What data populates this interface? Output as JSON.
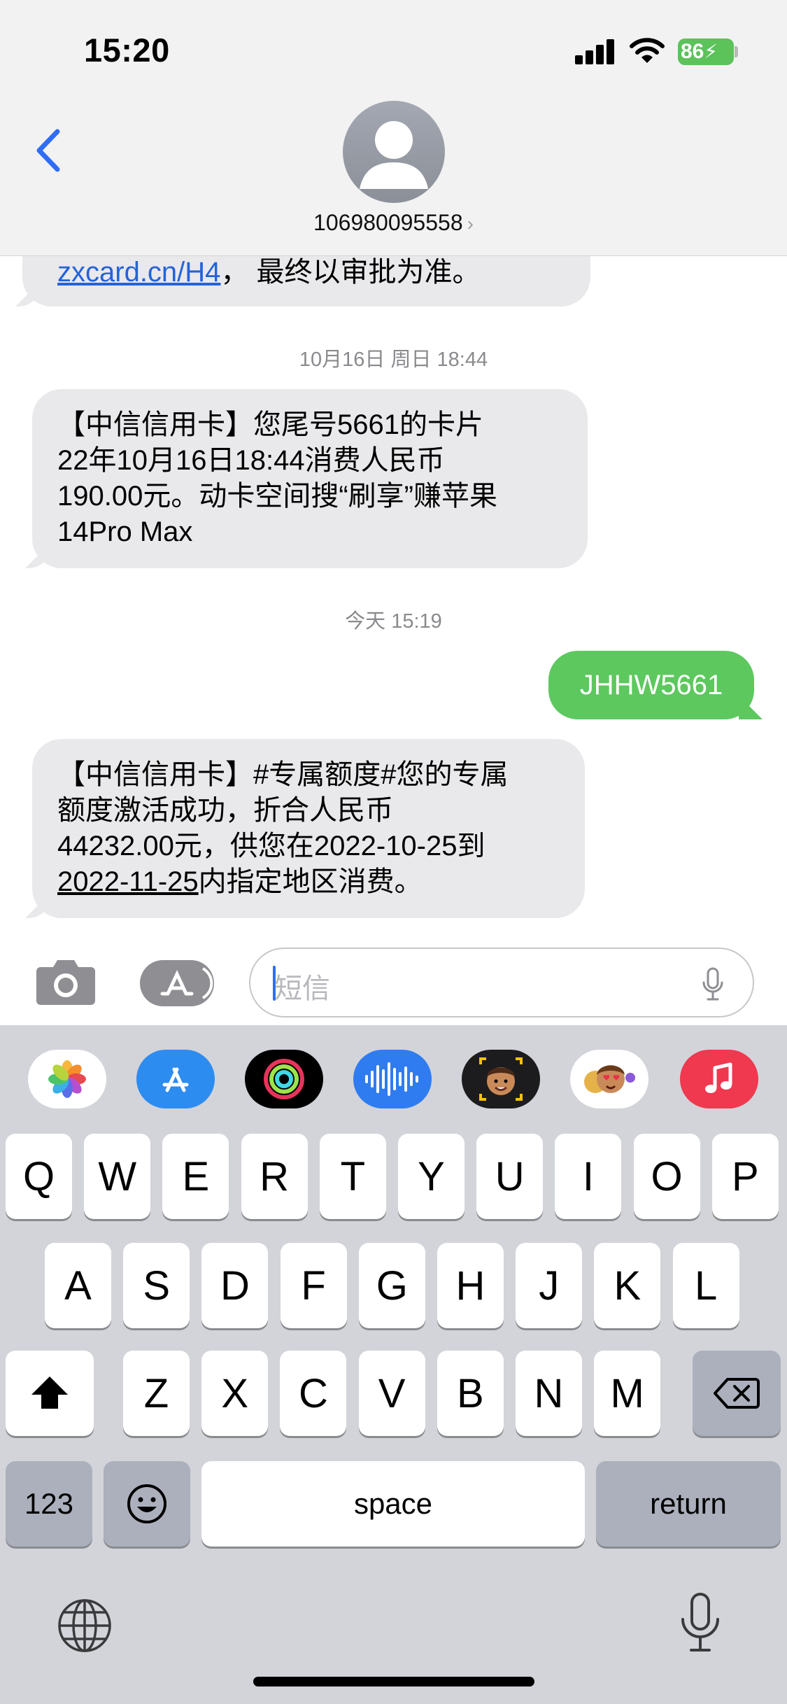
{
  "status_bar": {
    "time": "15:20",
    "battery": "86"
  },
  "header": {
    "contact": "106980095558"
  },
  "messages": {
    "m1": {
      "link": "zxcard.cn/H4",
      "rest": "， 最终以审批为准。"
    },
    "ts1": "10月16日 周日 18:44",
    "m2": {
      "l1": "【中信信用卡】您尾号5661的卡片",
      "l2": "22年10月16日18:44消费人民币",
      "l3": "190.00元。动卡空间搜“刷享”赚苹果",
      "l4": "14Pro Max"
    },
    "ts2": "今天 15:19",
    "m3": "JHHW5661",
    "m4": {
      "l1": "【中信信用卡】#专属额度#您的专属",
      "l2": "额度激活成功，折合人民币",
      "l3": "44232.00元，供您在2022-10-25到",
      "l4_date": "2022-11-25",
      "l4_rest": "内指定地区消费。"
    }
  },
  "input": {
    "placeholder": "短信"
  },
  "keyboard": {
    "row1": [
      "Q",
      "W",
      "E",
      "R",
      "T",
      "Y",
      "U",
      "I",
      "O",
      "P"
    ],
    "row2": [
      "A",
      "S",
      "D",
      "F",
      "G",
      "H",
      "J",
      "K",
      "L"
    ],
    "row3": [
      "Z",
      "X",
      "C",
      "V",
      "B",
      "N",
      "M"
    ],
    "numbers_label": "123",
    "space_label": "space",
    "return_label": "return"
  },
  "icons": {
    "app_strip": [
      "photos-icon",
      "app-store-icon",
      "activity-icon",
      "audio-message-icon",
      "memoji-icon",
      "memoji-stickers-icon",
      "music-icon"
    ]
  },
  "colors": {
    "incoming_bubble": "#e9e9eb",
    "outgoing_bubble": "#5cc85e",
    "link": "#2563d8",
    "accent": "#2f6df5",
    "battery": "#5cc25a"
  }
}
